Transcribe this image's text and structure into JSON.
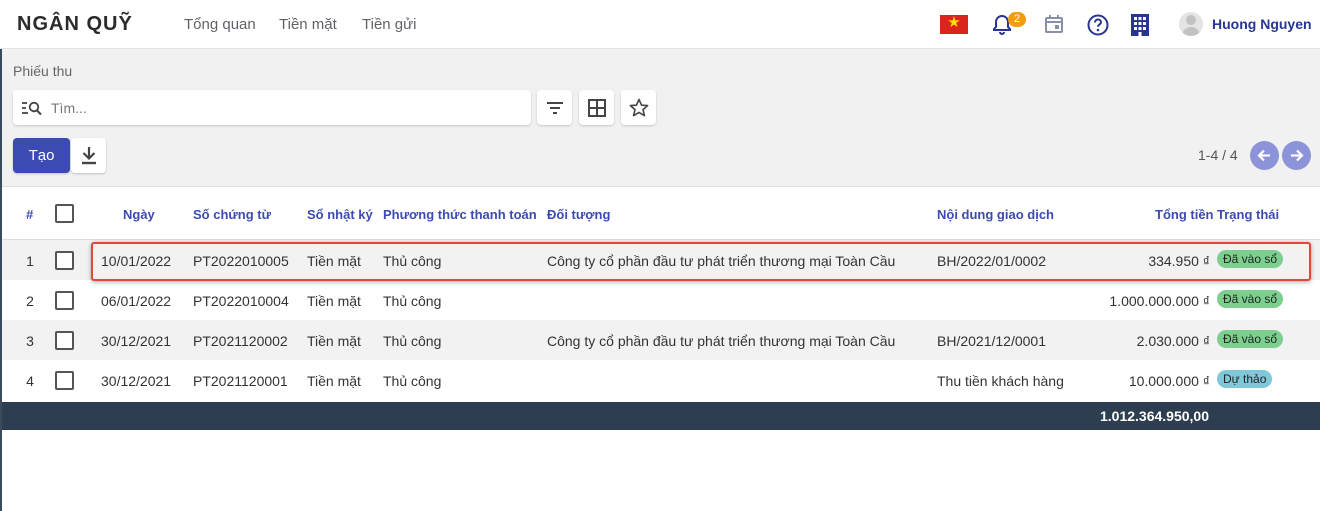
{
  "app": {
    "brand": "NGÂN QUỸ",
    "nav": [
      "Tổng quan",
      "Tiền mặt",
      "Tiền gửi"
    ],
    "notifications": "2",
    "user": "Huong Nguyen"
  },
  "control": {
    "breadcrumb": "Phiếu thu",
    "search_placeholder": "Tìm...",
    "create_label": "Tạo",
    "pager": "1-4 / 4"
  },
  "table": {
    "columns": {
      "index": "#",
      "date": "Ngày",
      "voucher": "Số chứng từ",
      "journal": "Sổ nhật ký",
      "method": "Phương thức thanh toán",
      "partner": "Đối tượng",
      "description": "Nội dung giao dịch",
      "total": "Tổng tiền",
      "status": "Trạng thái"
    },
    "rows": [
      {
        "index": "1",
        "date": "10/01/2022",
        "voucher": "PT2022010005",
        "journal": "Tiền mặt",
        "method": "Thủ công",
        "partner": "Công ty cổ phần đầu tư phát triển thương mại Toàn Cầu",
        "description": "BH/2022/01/0002",
        "total": "334.950 ₫",
        "status": "Đã vào sổ"
      },
      {
        "index": "2",
        "date": "06/01/2022",
        "voucher": "PT2022010004",
        "journal": "Tiền mặt",
        "method": "Thủ công",
        "partner": "",
        "description": "",
        "total": "1.000.000.000 ₫",
        "status": "Đã vào sổ"
      },
      {
        "index": "3",
        "date": "30/12/2021",
        "voucher": "PT2021120002",
        "journal": "Tiền mặt",
        "method": "Thủ công",
        "partner": "Công ty cổ phần đầu tư phát triển thương mại Toàn Cầu",
        "description": "BH/2021/12/0001",
        "total": "2.030.000 ₫",
        "status": "Đã vào sổ"
      },
      {
        "index": "4",
        "date": "30/12/2021",
        "voucher": "PT2021120001",
        "journal": "Tiền mặt",
        "method": "Thủ công",
        "partner": "",
        "description": "Thu tiền khách hàng",
        "total": "10.000.000 ₫",
        "status": "Dự thảo"
      }
    ],
    "grand_total": "1.012.364.950,00"
  },
  "colors": {
    "primary": "#3c4bb1",
    "status_posted": "#7dcf8e",
    "status_draft": "#7ec8da",
    "footer": "#2c3e50",
    "highlight": "#e0483a"
  }
}
